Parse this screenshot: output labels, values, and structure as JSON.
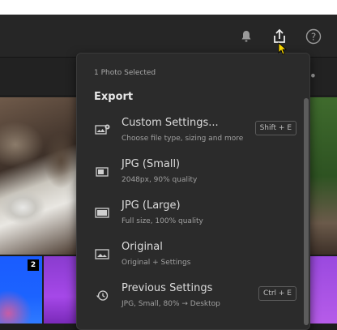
{
  "toolbar": {
    "icons": [
      "bell-icon",
      "share-export-icon",
      "help-icon"
    ]
  },
  "photos": {
    "badge_count": "2"
  },
  "export_panel": {
    "selection_text": "1 Photo Selected",
    "title": "Export",
    "items": [
      {
        "icon": "custom-settings-icon",
        "label": "Custom Settings...",
        "description": "Choose file type, sizing and more",
        "shortcut": "Shift + E"
      },
      {
        "icon": "jpg-small-icon",
        "label": "JPG (Small)",
        "description": "2048px, 90% quality",
        "shortcut": ""
      },
      {
        "icon": "jpg-large-icon",
        "label": "JPG (Large)",
        "description": "Full size, 100% quality",
        "shortcut": ""
      },
      {
        "icon": "image-icon",
        "label": "Original",
        "description": "Original + Settings",
        "shortcut": ""
      },
      {
        "icon": "history-icon",
        "label": "Previous Settings",
        "description": "JPG, Small, 80% → Desktop",
        "shortcut": "Ctrl + E"
      }
    ]
  },
  "colors": {
    "background": "#1d1d1d",
    "panel": "#2b2b2b",
    "cursor": "#f5d200"
  }
}
